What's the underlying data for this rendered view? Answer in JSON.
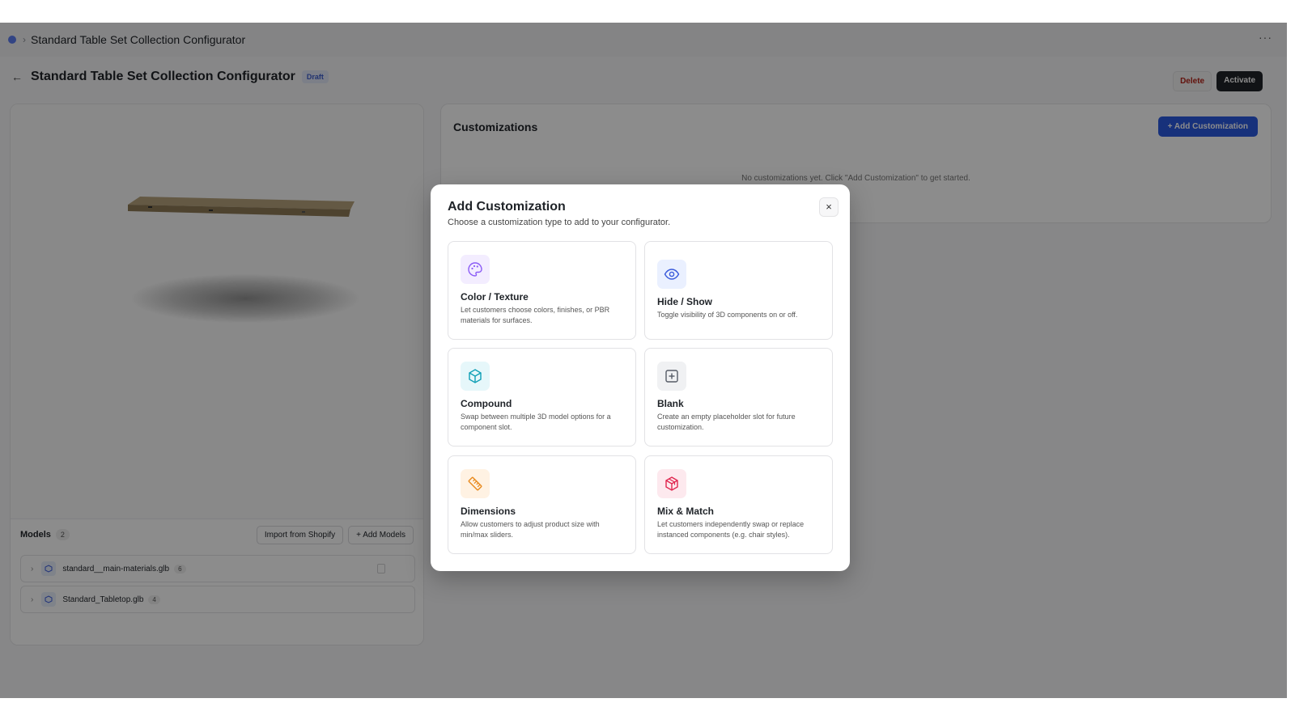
{
  "appbar": {
    "title": "Standard Table Set Collection Configurator",
    "separator": "›",
    "more": "···"
  },
  "page": {
    "back": "←",
    "title": "Standard Table Set Collection Configurator",
    "status_badge": "Draft",
    "delete_label": "Delete",
    "activate_label": "Activate"
  },
  "models": {
    "label": "Models",
    "count": "2",
    "import_label": "Import from Shopify",
    "add_label": "+ Add Models",
    "items": [
      {
        "name": "standard__main-materials.glb",
        "count": "6"
      },
      {
        "name": "Standard_Tabletop.glb",
        "count": "4"
      }
    ]
  },
  "customizations": {
    "title": "Customizations",
    "add_label": "+ Add Customization",
    "empty_text": "No customizations yet. Click \"Add Customization\" to get started."
  },
  "modal": {
    "title": "Add Customization",
    "subtitle": "Choose a customization type to add to your configurator.",
    "close": "×",
    "options": [
      {
        "icon": "palette-icon",
        "title": "Color / Texture",
        "description": "Let customers choose colors, finishes, or PBR materials for surfaces.",
        "color": "#8b5cf6",
        "bg": "#f3edff"
      },
      {
        "icon": "eye-icon",
        "title": "Hide / Show",
        "description": "Toggle visibility of 3D components on or off.",
        "color": "#3b5bdb",
        "bg": "#eaf0ff"
      },
      {
        "icon": "box-icon",
        "title": "Compound",
        "description": "Swap between multiple 3D model options for a component slot.",
        "color": "#0e9fb5",
        "bg": "#e6f7fa"
      },
      {
        "icon": "plus-square-icon",
        "title": "Blank",
        "description": "Create an empty placeholder slot for future customization.",
        "color": "#555b66",
        "bg": "#f0f1f3"
      },
      {
        "icon": "ruler-icon",
        "title": "Dimensions",
        "description": "Allow customers to adjust product size with min/max sliders.",
        "color": "#e8891c",
        "bg": "#fff2e3"
      },
      {
        "icon": "boxes-icon",
        "title": "Mix & Match",
        "description": "Let customers independently swap or replace instanced components (e.g. chair styles).",
        "color": "#e0264f",
        "bg": "#fde9ee"
      }
    ]
  },
  "colors": {
    "primary": "#2b59e0",
    "danger": "#b42318",
    "dark": "#1f2328"
  }
}
